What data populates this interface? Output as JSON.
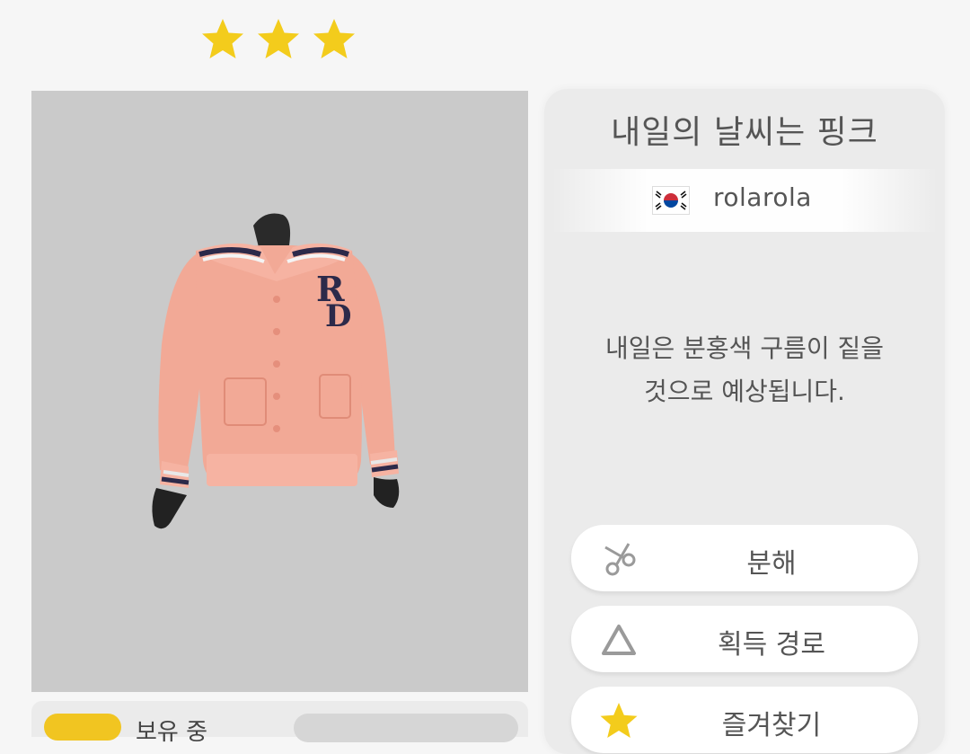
{
  "rarity": {
    "stars": 3,
    "star_color": "#f3cc1c"
  },
  "item": {
    "title": "내일의 날씨는 핑크",
    "creator": "rolarola",
    "creator_flag": "korea-flag-icon",
    "description_line1": "내일은 분홍색 구름이 짙을",
    "description_line2": "것으로 예상됩니다.",
    "preview_bg": "#cacaca",
    "garment_color": "#f2a996"
  },
  "actions": [
    {
      "label": "분해",
      "icon": "scissors-icon"
    },
    {
      "label": "획득 경로",
      "icon": "triangle-icon"
    },
    {
      "label": "즐겨찾기",
      "icon": "star-icon"
    }
  ],
  "owned": {
    "label": "보유 중"
  }
}
